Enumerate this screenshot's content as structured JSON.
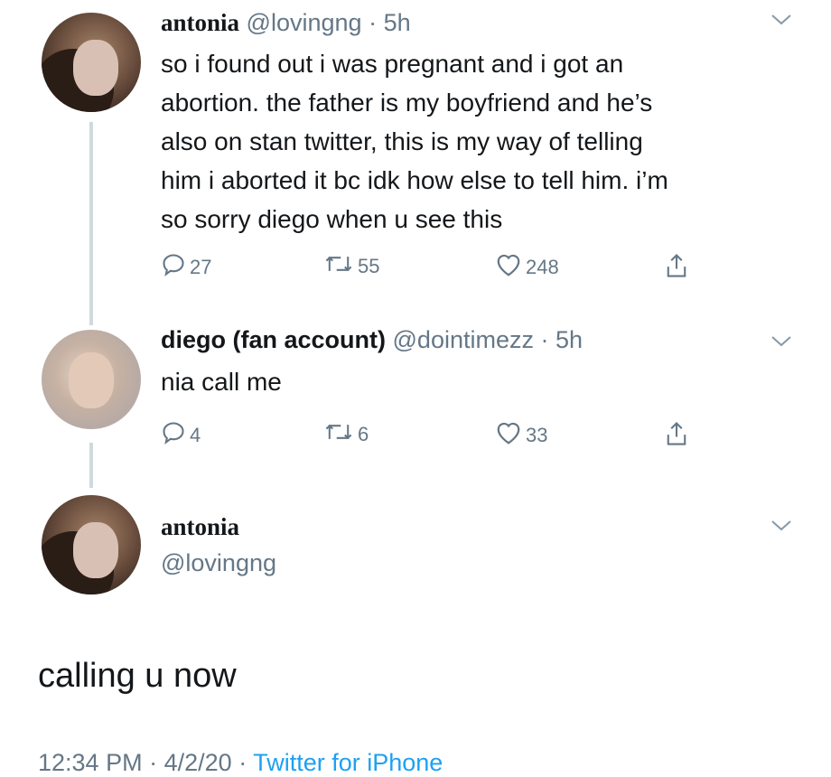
{
  "tweets": [
    {
      "name": "antonia",
      "handle": "@lovingng",
      "sep": "·",
      "time": "5h",
      "text_lines": [
        "so i found out i was pregnant and i got an",
        "abortion. the father is my boyfriend and he’s",
        "also on stan twitter, this is my way of telling",
        "him i aborted it bc idk how else to tell him. i’m",
        "so sorry diego when u see this"
      ],
      "replies": "27",
      "retweets": "55",
      "likes": "248"
    },
    {
      "name": "diego (fan account)",
      "handle": "@dointimezz",
      "sep": "·",
      "time": "5h",
      "text_lines": [
        "nia call me"
      ],
      "replies": "4",
      "retweets": "6",
      "likes": "33"
    }
  ],
  "main_tweet": {
    "name": "antonia",
    "handle": "@lovingng",
    "text": "calling u now",
    "time": "12:34 PM",
    "sep1": "·",
    "date": "4/2/20",
    "sep2": "·",
    "source": "Twitter for iPhone"
  },
  "icons": {
    "reply": "reply-icon",
    "retweet": "retweet-icon",
    "like": "heart-icon",
    "share": "share-icon",
    "caret": "chevron-down-icon"
  },
  "colors": {
    "text": "#14171a",
    "secondary": "#657786",
    "link": "#1da1f2",
    "thread_line": "#cfd9de"
  }
}
